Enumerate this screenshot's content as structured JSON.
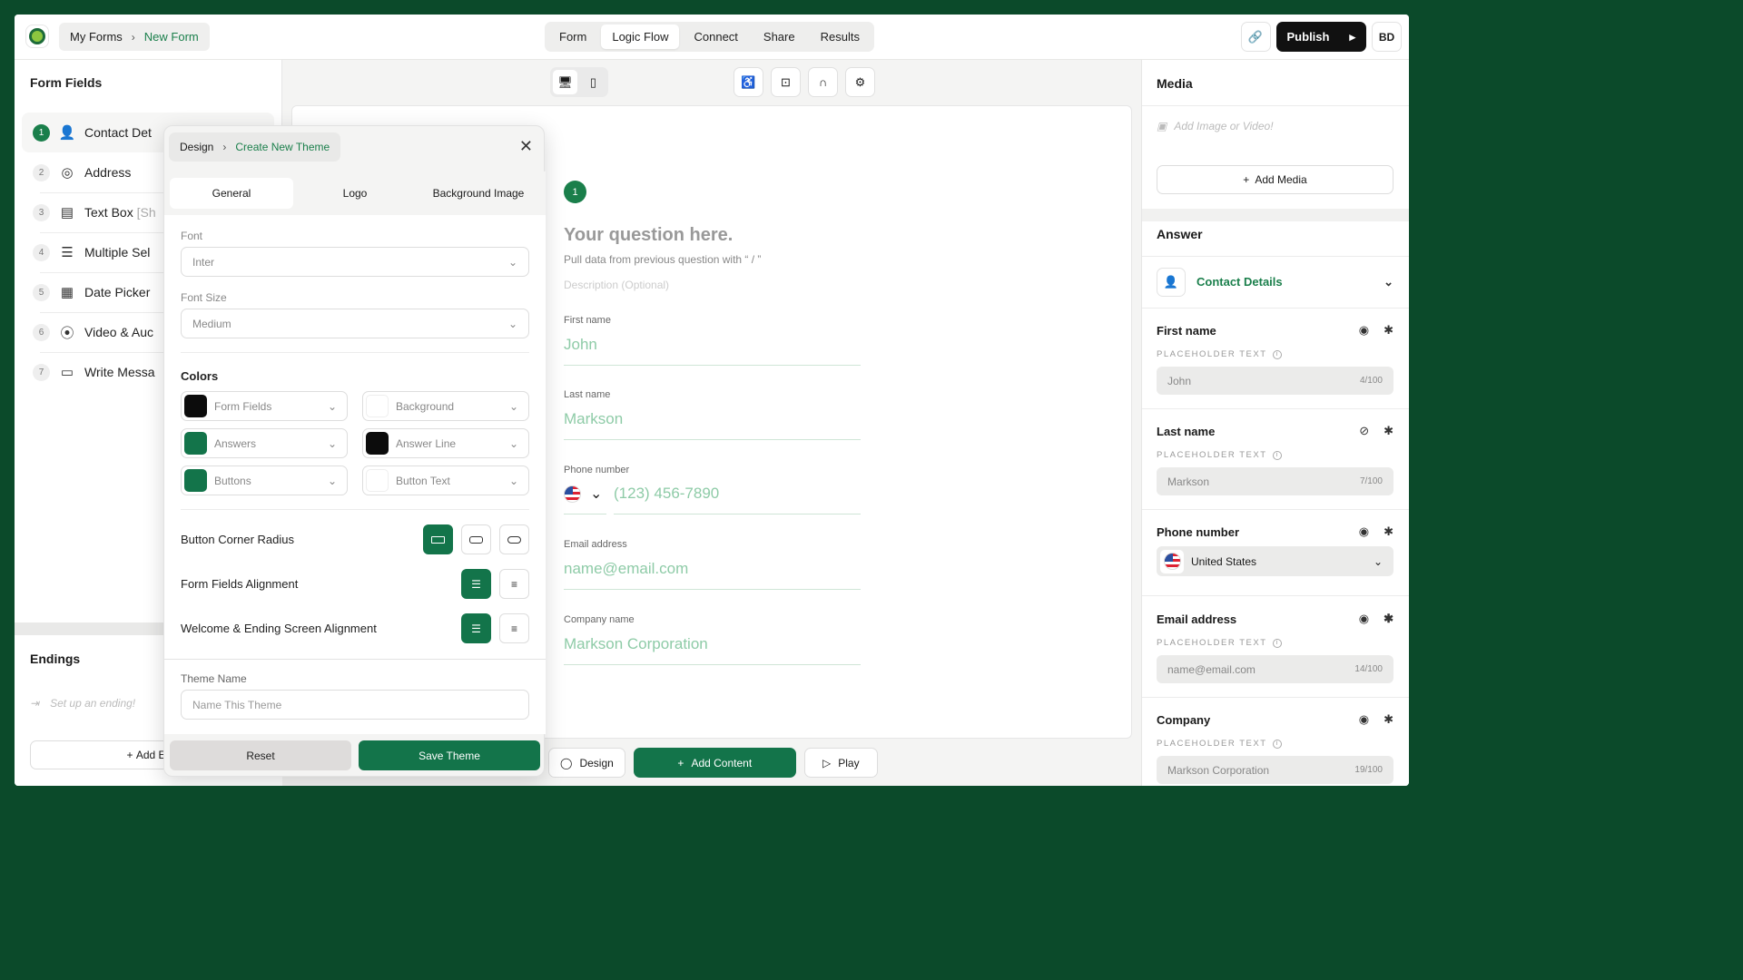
{
  "topbar": {
    "breadcrumb": {
      "root": "My Forms",
      "current": "New Form"
    },
    "tabs": [
      "Form",
      "Logic Flow",
      "Connect",
      "Share",
      "Results"
    ],
    "active_tab": "Logic Flow",
    "publish_label": "Publish",
    "avatar_initials": "BD"
  },
  "left_panel": {
    "title": "Form Fields",
    "fields": [
      {
        "num": "1",
        "label": "Contact Det",
        "icon": "person-icon"
      },
      {
        "num": "2",
        "label": "Address",
        "icon": "location-icon"
      },
      {
        "num": "3",
        "label": "Text Box",
        "suffix": "[Sh",
        "icon": "textbox-icon"
      },
      {
        "num": "4",
        "label": "Multiple Sel",
        "icon": "list-icon"
      },
      {
        "num": "5",
        "label": "Date Picker",
        "icon": "calendar-icon"
      },
      {
        "num": "6",
        "label": "Video & Auc",
        "icon": "video-icon"
      },
      {
        "num": "7",
        "label": "Write Messa",
        "icon": "message-icon"
      }
    ],
    "endings_title": "Endings",
    "endings_placeholder": "Set up an ending!",
    "add_endings_label": "Add Er"
  },
  "canvas": {
    "question_number": "1",
    "question_title": "Your question here.",
    "question_hint": "Pull data from previous question with “ / ”",
    "description_placeholder": "Description (Optional)",
    "fields": [
      {
        "label": "First name",
        "value": "John"
      },
      {
        "label": "Last name",
        "value": "Markson"
      },
      {
        "label": "Phone number",
        "value": "(123) 456-7890"
      },
      {
        "label": "Email address",
        "value": "name@email.com"
      },
      {
        "label": "Company name",
        "value": "Markson Corporation"
      }
    ],
    "bottom": {
      "design": "Design",
      "add_content": "Add Content",
      "play": "Play"
    }
  },
  "theme_dialog": {
    "breadcrumb_root": "Design",
    "breadcrumb_current": "Create New Theme",
    "tabs": [
      "General",
      "Logo",
      "Background Image"
    ],
    "font_label": "Font",
    "font_value": "Inter",
    "font_size_label": "Font Size",
    "font_size_value": "Medium",
    "colors_label": "Colors",
    "colors": [
      {
        "label": "Form Fields",
        "color": "#0c0c0c"
      },
      {
        "label": "Background",
        "color": "#ffffff"
      },
      {
        "label": "Answers",
        "color": "#13744a"
      },
      {
        "label": "Answer Line",
        "color": "#0c0c0c"
      },
      {
        "label": "Buttons",
        "color": "#13744a"
      },
      {
        "label": "Button Text",
        "color": "#ffffff"
      }
    ],
    "corner_radius_label": "Button Corner Radius",
    "fields_alignment_label": "Form Fields Alignment",
    "screen_alignment_label": "Welcome & Ending Screen Alignment",
    "theme_name_label": "Theme Name",
    "theme_name_placeholder": "Name This Theme",
    "reset_label": "Reset",
    "save_label": "Save Theme"
  },
  "right_panel": {
    "media_title": "Media",
    "media_placeholder": "Add Image or Video!",
    "add_media_label": "Add Media",
    "answer_title": "Answer",
    "answer_type": "Contact Details",
    "placeholder_caption": "PLACEHOLDER TEXT",
    "fields": [
      {
        "label": "First name",
        "placeholder": "John",
        "count": "4/100"
      },
      {
        "label": "Last name",
        "placeholder": "Markson",
        "count": "7/100"
      },
      {
        "label": "Phone number",
        "country": "United States"
      },
      {
        "label": "Email address",
        "placeholder": "name@email.com",
        "count": "14/100"
      },
      {
        "label": "Company",
        "placeholder": "Markson Corporation",
        "count": "19/100"
      }
    ]
  },
  "colors": {
    "brand_green": "#13744a",
    "accent_green": "#1a7f4b",
    "frame": "#0b4a2a"
  }
}
